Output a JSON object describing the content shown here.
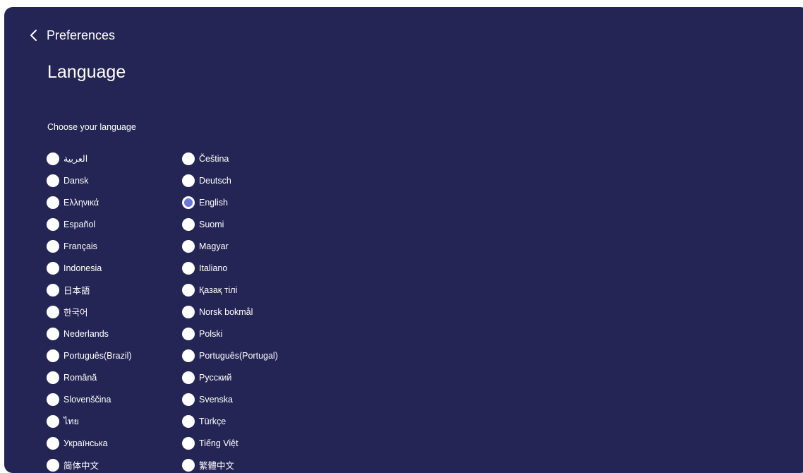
{
  "header": {
    "back_label": "Preferences",
    "title": "Language"
  },
  "section": {
    "label": "Choose your language"
  },
  "colors": {
    "background": "#252555",
    "selected_accent": "#6a77d6",
    "text": "#ffffff"
  },
  "selected_language": "English",
  "languages": {
    "col1": [
      {
        "label": "العربية"
      },
      {
        "label": "Dansk"
      },
      {
        "label": "Ελληνικά"
      },
      {
        "label": "Español"
      },
      {
        "label": "Français"
      },
      {
        "label": "Indonesia"
      },
      {
        "label": "日本語"
      },
      {
        "label": "한국어"
      },
      {
        "label": "Nederlands"
      },
      {
        "label": "Português(Brazil)"
      },
      {
        "label": "Română"
      },
      {
        "label": "Slovenščina"
      },
      {
        "label": "ไทย"
      },
      {
        "label": "Українська"
      },
      {
        "label": "简体中文"
      }
    ],
    "col2": [
      {
        "label": "Čeština"
      },
      {
        "label": "Deutsch"
      },
      {
        "label": "English"
      },
      {
        "label": "Suomi"
      },
      {
        "label": "Magyar"
      },
      {
        "label": "Italiano"
      },
      {
        "label": "Қазақ тілі"
      },
      {
        "label": "Norsk bokmål"
      },
      {
        "label": "Polski"
      },
      {
        "label": "Português(Portugal)"
      },
      {
        "label": "Русский"
      },
      {
        "label": "Svenska"
      },
      {
        "label": "Türkçe"
      },
      {
        "label": "Tiếng Việt"
      },
      {
        "label": "繁體中文"
      }
    ]
  }
}
